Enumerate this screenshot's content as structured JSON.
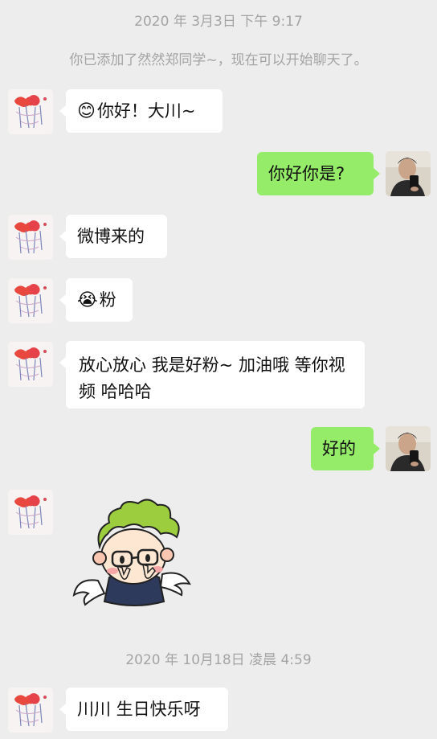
{
  "timestamps": {
    "first": "2020 年 3月3日 下午 9:17",
    "second": "2020 年 10月18日 凌晨 4:59"
  },
  "system_notice": "你已添加了然然郑同学~，现在可以开始聊天了。",
  "messages": {
    "m1": {
      "emoji": "😊",
      "text": "你好！大川~"
    },
    "m2": {
      "text": "你好你是?"
    },
    "m3": {
      "text": "微博来的"
    },
    "m4": {
      "emoji": "😭",
      "text": "粉"
    },
    "m5": {
      "text": "放心放心 我是好粉~ 加油哦 等你视频 哈哈哈"
    },
    "m6": {
      "text": "好的"
    },
    "m7": {
      "type": "sticker",
      "icon": "cartoon-green-hair-sticker"
    },
    "m8": {
      "text": "川川 生日快乐呀"
    }
  },
  "colors": {
    "background": "#ededed",
    "incoming_bubble": "#ffffff",
    "outgoing_bubble": "#95ec69",
    "system_text": "#a4a4a4"
  }
}
